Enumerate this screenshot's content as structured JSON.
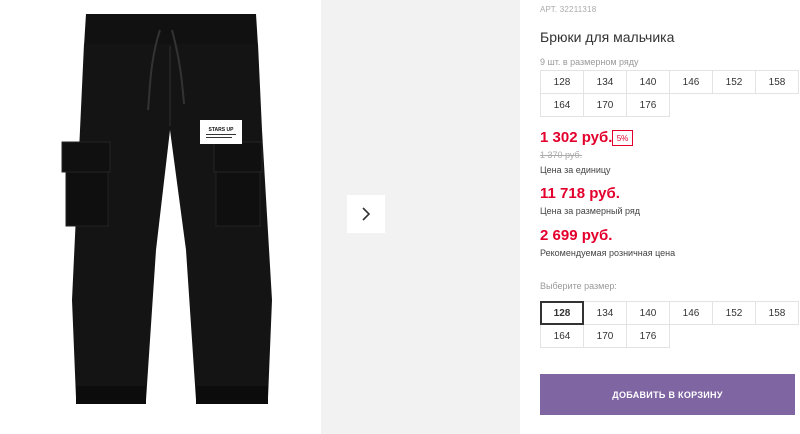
{
  "product": {
    "article": "АРТ. 32211318",
    "title": "Брюки для мальчика",
    "pack_note": "9 шт. в размерном ряду",
    "pack_sizes": [
      "128",
      "134",
      "140",
      "146",
      "152",
      "158",
      "164",
      "170",
      "176"
    ],
    "price": "1 302 руб.",
    "discount": "5%",
    "old_price": "1 370 руб.",
    "price_caption": "Цена за единицу",
    "pack_price": "11 718 руб.",
    "pack_price_caption": "Цена за размерный ряд",
    "retail_price": "2 699 руб.",
    "retail_caption": "Рекомендуемая розничная цена",
    "choose_size_label": "Выберите размер:",
    "sizes": [
      "128",
      "134",
      "140",
      "146",
      "152",
      "158",
      "164",
      "170",
      "176"
    ],
    "selected_size": "128",
    "add_to_cart": "ДОБАВИТЬ В КОРЗИНУ",
    "patch_text": "STARS UP"
  },
  "colors": {
    "accent_red": "#e3002c",
    "button_purple": "#7f65a2",
    "garment": "#121212"
  },
  "icons": {
    "gallery_next": "chevron-right-icon"
  }
}
